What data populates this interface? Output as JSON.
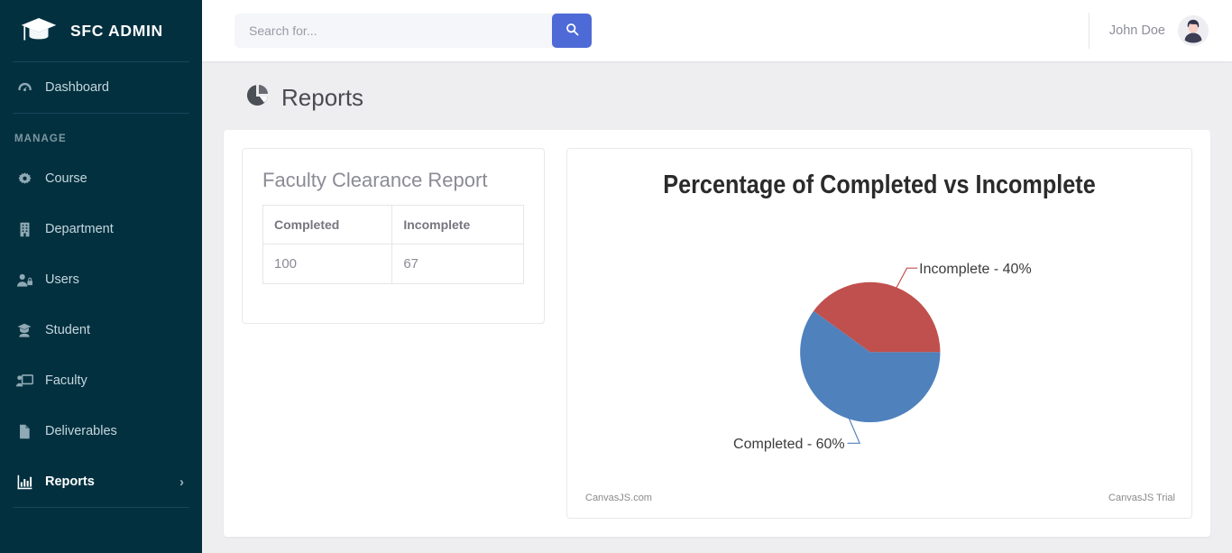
{
  "brand": {
    "title": "SFC ADMIN",
    "logo_icon": "graduation-cap-icon"
  },
  "sidebar": {
    "section_label": "MANAGE",
    "items": [
      {
        "label": "Dashboard",
        "icon": "dashboard-gauge-icon",
        "active": false
      },
      {
        "label": "Course",
        "icon": "gear-icon",
        "active": false
      },
      {
        "label": "Department",
        "icon": "building-icon",
        "active": false
      },
      {
        "label": "Users",
        "icon": "user-lock-icon",
        "active": false
      },
      {
        "label": "Student",
        "icon": "student-icon",
        "active": false
      },
      {
        "label": "Faculty",
        "icon": "chalkboard-user-icon",
        "active": false
      },
      {
        "label": "Deliverables",
        "icon": "file-icon",
        "active": false
      },
      {
        "label": "Reports",
        "icon": "bar-chart-icon",
        "active": true
      }
    ]
  },
  "topbar": {
    "search": {
      "placeholder": "Search for...",
      "value": "",
      "button_icon": "search-icon"
    },
    "user": {
      "name": "John Doe",
      "avatar_icon": "user-avatar"
    }
  },
  "page": {
    "title": "Reports",
    "title_icon": "pie-chart-icon"
  },
  "report_card": {
    "title": "Faculty Clearance Report",
    "columns": [
      "Completed",
      "Incomplete"
    ],
    "rows": [
      [
        "100",
        "67"
      ]
    ]
  },
  "chart_credits": {
    "left": "CanvasJS.com",
    "right": "CanvasJS Trial"
  },
  "chart_data": {
    "type": "pie",
    "title": "Percentage of Completed vs Incomplete",
    "labels": [
      "Incomplete - 40%",
      "Completed - 60%"
    ],
    "slices": [
      {
        "name": "Incomplete",
        "value": 40,
        "label": "Incomplete - 40%",
        "color": "#c0504d"
      },
      {
        "name": "Completed",
        "value": 60,
        "label": "Completed - 60%",
        "color": "#4f81bd"
      }
    ],
    "legend": "none",
    "start_angle_deg": 0,
    "unit": "%"
  }
}
